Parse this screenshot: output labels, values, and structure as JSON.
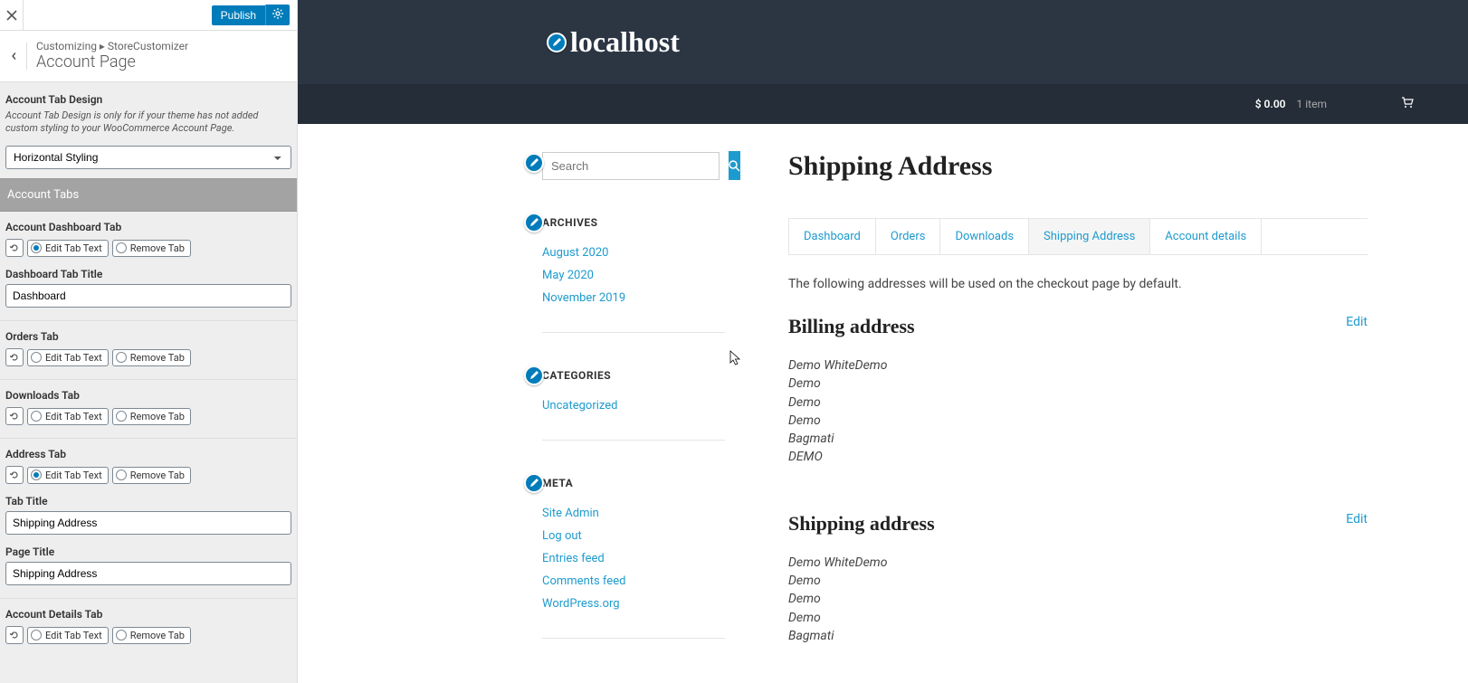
{
  "sidebar": {
    "publish_label": "Publish",
    "breadcrumb_prefix": "Customizing ▸ StoreCustomizer",
    "breadcrumb_title": "Account Page",
    "design_section": {
      "label": "Account Tab Design",
      "description": "Account Tab Design is only for if your theme has not added custom styling to your WooCommerce Account Page.",
      "select_value": "Horizontal Styling"
    },
    "tabs_header": "Account Tabs",
    "tabs": [
      {
        "heading": "Account Dashboard Tab",
        "edit_label": "Edit Tab Text",
        "remove_label": "Remove Tab",
        "edit_checked": true,
        "subfields": [
          {
            "label": "Dashboard Tab Title",
            "value": "Dashboard"
          }
        ]
      },
      {
        "heading": "Orders Tab",
        "edit_label": "Edit Tab Text",
        "remove_label": "Remove Tab",
        "edit_checked": false,
        "subfields": []
      },
      {
        "heading": "Downloads Tab",
        "edit_label": "Edit Tab Text",
        "remove_label": "Remove Tab",
        "edit_checked": false,
        "subfields": []
      },
      {
        "heading": "Address Tab",
        "edit_label": "Edit Tab Text",
        "remove_label": "Remove Tab",
        "edit_checked": true,
        "subfields": [
          {
            "label": "Tab Title",
            "value": "Shipping Address"
          },
          {
            "label": "Page Title",
            "value": "Shipping Address"
          }
        ]
      },
      {
        "heading": "Account Details Tab",
        "edit_label": "Edit Tab Text",
        "remove_label": "Remove Tab",
        "edit_checked": false,
        "subfields": []
      }
    ]
  },
  "preview": {
    "site_title": "localhost",
    "cart_price": "$ 0.00",
    "cart_count": "1 item",
    "search_placeholder": "Search",
    "widgets": [
      {
        "title": "ARCHIVES",
        "items": [
          "August 2020",
          "May 2020",
          "November 2019"
        ]
      },
      {
        "title": "CATEGORIES",
        "items": [
          "Uncategorized"
        ]
      },
      {
        "title": "META",
        "items": [
          "Site Admin",
          "Log out",
          "Entries feed",
          "Comments feed",
          "WordPress.org"
        ]
      }
    ],
    "page_title": "Shipping Address",
    "account_tabs": [
      {
        "label": "Dashboard",
        "active": false
      },
      {
        "label": "Orders",
        "active": false
      },
      {
        "label": "Downloads",
        "active": false
      },
      {
        "label": "Shipping Address",
        "active": true
      },
      {
        "label": "Account details",
        "active": false
      }
    ],
    "intro_text": "The following addresses will be used on the checkout page by default.",
    "addresses": [
      {
        "title": "Billing address",
        "edit_label": "Edit",
        "lines": [
          "Demo WhiteDemo",
          "Demo",
          "Demo",
          "Demo",
          "Bagmati",
          "DEMO"
        ]
      },
      {
        "title": "Shipping address",
        "edit_label": "Edit",
        "lines": [
          "Demo WhiteDemo",
          "Demo",
          "Demo",
          "Demo",
          "Bagmati"
        ]
      }
    ]
  }
}
